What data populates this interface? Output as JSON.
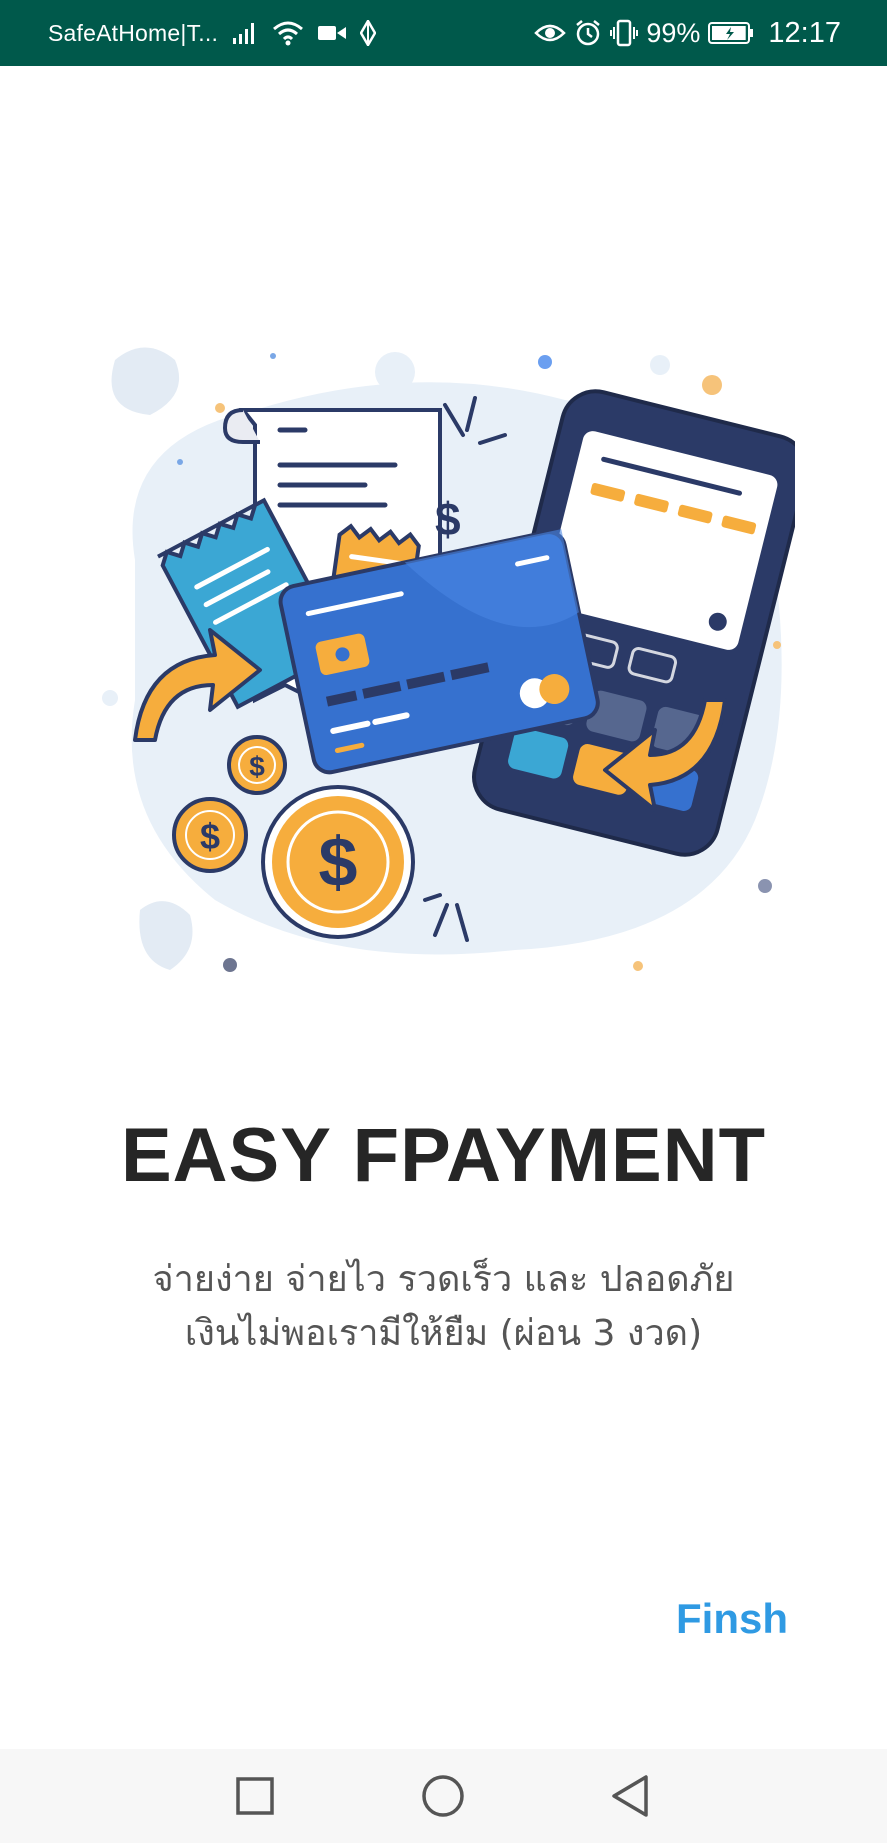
{
  "status_bar": {
    "carrier": "SafeAtHome|T...",
    "battery_percent": "99%",
    "time": "12:17",
    "battery_level": 0.99,
    "icons": [
      "signal-icon",
      "wifi-icon",
      "video-icon",
      "data-icon",
      "eye-icon",
      "alarm-icon",
      "vibrate-icon",
      "battery-icon"
    ]
  },
  "onboarding": {
    "illustration": "payment-illustration",
    "title": "EASY FPAYMENT",
    "description_line1": "จ่ายง่าย จ่ายไว รวดเร็ว และ ปลอดภัย",
    "description_line2": "เงินไม่พอเรามีให้ยืม (ผ่อน 3 งวด)",
    "finish_label": "Finsh"
  },
  "nav_bar": {
    "buttons": [
      "recent-apps",
      "home",
      "back"
    ]
  },
  "colors": {
    "status_bar": "#00594b",
    "title": "#262626",
    "description": "#555555",
    "accent": "#2f9ae3",
    "navy": "#2b3a67",
    "orange": "#f6ad3d",
    "blue": "#3671cf"
  }
}
